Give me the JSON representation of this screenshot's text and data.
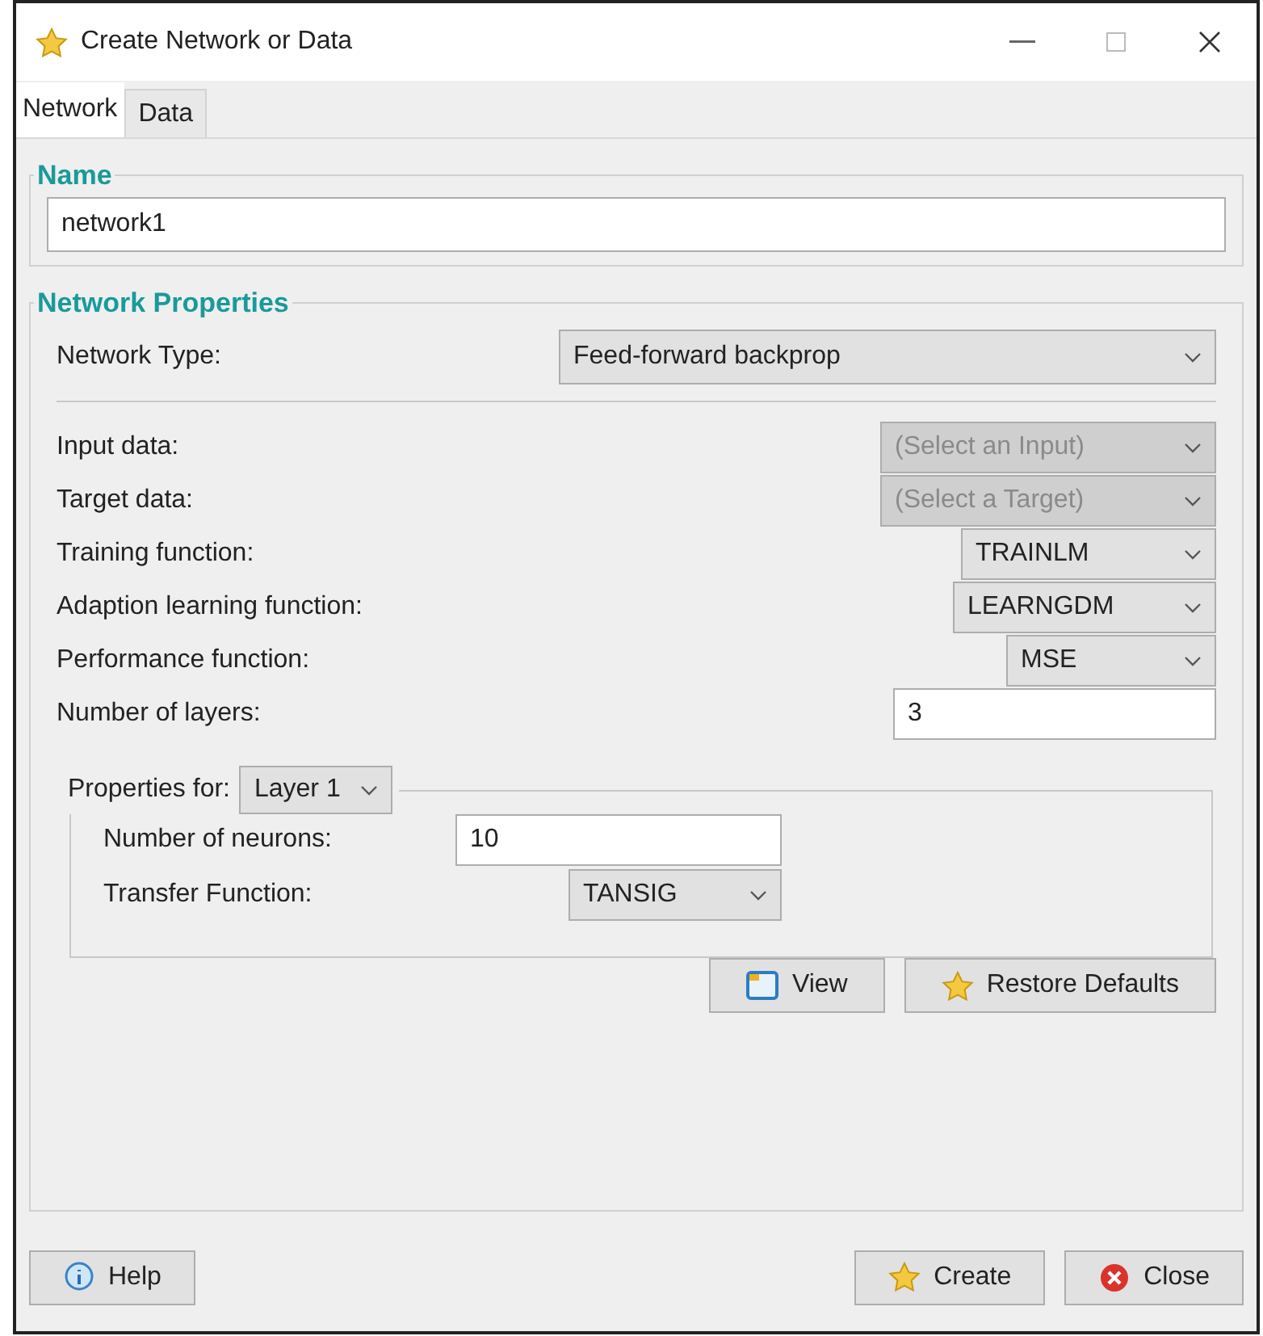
{
  "window": {
    "title": "Create Network or Data"
  },
  "tabs": [
    {
      "label": "Network",
      "selected": true
    },
    {
      "label": "Data",
      "selected": false
    }
  ],
  "name_group": {
    "title": "Name",
    "value": "network1"
  },
  "properties": {
    "title": "Network Properties",
    "network_type": {
      "label": "Network Type:",
      "value": "Feed-forward backprop"
    },
    "rows": [
      {
        "kind": "select",
        "label": "Input data:",
        "value": "(Select an Input)",
        "disabled": true
      },
      {
        "kind": "select",
        "label": "Target data:",
        "value": "(Select a Target)",
        "disabled": true
      },
      {
        "kind": "select",
        "label": "Training function:",
        "value": "TRAINLM",
        "disabled": false
      },
      {
        "kind": "select",
        "label": "Adaption learning function:",
        "value": "LEARNGDM",
        "disabled": false
      },
      {
        "kind": "select",
        "label": "Performance function:",
        "value": "MSE",
        "disabled": false
      },
      {
        "kind": "input",
        "label": "Number of layers:",
        "value": "3"
      }
    ],
    "layer_group": {
      "label": "Properties for:",
      "layer": "Layer 1",
      "rows": [
        {
          "kind": "input",
          "label": "Number of neurons:",
          "value": "10"
        },
        {
          "kind": "select",
          "label": "Transfer Function:",
          "value": "TANSIG",
          "disabled": false
        }
      ]
    },
    "buttons": [
      {
        "label": "View"
      },
      {
        "label": "Restore Defaults"
      }
    ]
  },
  "footer_buttons": [
    {
      "label": "Help"
    },
    {
      "label": "Create"
    },
    {
      "label": "Close"
    }
  ]
}
